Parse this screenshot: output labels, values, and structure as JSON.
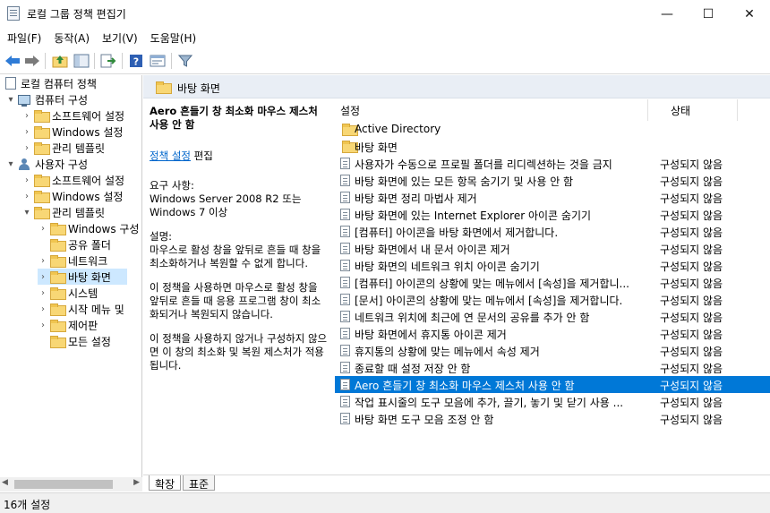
{
  "window": {
    "title": "로컬 그룹 정책 편집기",
    "minimize": "—",
    "maximize": "☐",
    "close": "✕"
  },
  "menu": [
    "파일(F)",
    "동작(A)",
    "보기(V)",
    "도움말(H)"
  ],
  "toolbar": {
    "icons": [
      "back-arrow-icon",
      "forward-arrow-icon",
      "up-folder-icon",
      "show-hide-tree-icon",
      "export-list-icon",
      "help-icon",
      "properties-icon",
      "filter-icon"
    ]
  },
  "tree": {
    "items": [
      {
        "label": "로컬 컴퓨터 정책"
      },
      {
        "label": "컴퓨터 구성"
      },
      {
        "label": "소프트웨어 설정"
      },
      {
        "label": "Windows 설정"
      },
      {
        "label": "관리 템플릿"
      },
      {
        "label": "사용자 구성"
      },
      {
        "label": "소프트웨어 설정"
      },
      {
        "label": "Windows 설정"
      },
      {
        "label": "관리 템플릿"
      },
      {
        "label": "Windows 구성"
      },
      {
        "label": "공유 폴더"
      },
      {
        "label": "네트워크"
      },
      {
        "label": "바탕 화면"
      },
      {
        "label": "시스템"
      },
      {
        "label": "시작 메뉴 및"
      },
      {
        "label": "제어판"
      },
      {
        "label": "모든 설정"
      }
    ]
  },
  "header": {
    "folder_title": "바탕 화면"
  },
  "description": {
    "title": "Aero 흔들기 창 최소화 마우스 제스처 사용 안 함",
    "edit_link": "정책 설정",
    "edit_suffix": " 편집",
    "requirements": "요구 사항:\nWindows Server 2008 R2 또는 Windows 7 이상",
    "description": "설명:\n마우스로 활성 창을 앞뒤로 흔들 때 창을 최소화하거나 복원할 수 없게 합니다.",
    "enabled_text": "이 정책을 사용하면 마우스로 활성 창을 앞뒤로 흔들 때 응용 프로그램 창이 최소화되거나 복원되지 않습니다.",
    "disabled_text": "이 정책을 사용하지 않거나 구성하지 않으면 이 창의 최소화 및 복원 제스처가 적용됩니다."
  },
  "columns": {
    "setting": "설정",
    "state": "상태"
  },
  "rows": [
    {
      "type": "folder",
      "name": "Active Directory",
      "state": ""
    },
    {
      "type": "folder",
      "name": "바탕 화면",
      "state": ""
    },
    {
      "type": "setting",
      "name": "사용자가 수동으로 프로필 폴더를 리디렉션하는 것을 금지",
      "state": "구성되지 않음"
    },
    {
      "type": "setting",
      "name": "바탕 화면에 있는 모든 항목 숨기기 및 사용 안 함",
      "state": "구성되지 않음"
    },
    {
      "type": "setting",
      "name": "바탕 화면 정리 마법사 제거",
      "state": "구성되지 않음"
    },
    {
      "type": "setting",
      "name": "바탕 화면에 있는 Internet Explorer 아이콘 숨기기",
      "state": "구성되지 않음"
    },
    {
      "type": "setting",
      "name": "[컴퓨터] 아이콘을 바탕 화면에서 제거합니다.",
      "state": "구성되지 않음"
    },
    {
      "type": "setting",
      "name": "바탕 화면에서 내 문서 아이콘 제거",
      "state": "구성되지 않음"
    },
    {
      "type": "setting",
      "name": "바탕 화면의 네트워크 위치 아이콘 숨기기",
      "state": "구성되지 않음"
    },
    {
      "type": "setting",
      "name": "[컴퓨터] 아이콘의 상황에 맞는 메뉴에서 [속성]을 제거합니...",
      "state": "구성되지 않음"
    },
    {
      "type": "setting",
      "name": "[문서] 아이콘의 상황에 맞는 메뉴에서 [속성]을 제거합니다.",
      "state": "구성되지 않음"
    },
    {
      "type": "setting",
      "name": "네트워크 위치에 최근에 연 문서의 공유를 추가 안 함",
      "state": "구성되지 않음"
    },
    {
      "type": "setting",
      "name": "바탕 화면에서 휴지통 아이콘 제거",
      "state": "구성되지 않음"
    },
    {
      "type": "setting",
      "name": "휴지통의 상황에 맞는 메뉴에서 속성 제거",
      "state": "구성되지 않음"
    },
    {
      "type": "setting",
      "name": "종료할 때 설정 저장 안 함",
      "state": "구성되지 않음"
    },
    {
      "type": "setting",
      "name": "Aero 흔들기 창 최소화 마우스 제스처 사용 안 함",
      "state": "구성되지 않음"
    },
    {
      "type": "setting",
      "name": "작업 표시줄의 도구 모음에 추가, 끌기, 놓기 및 닫기 사용 ...",
      "state": "구성되지 않음"
    },
    {
      "type": "setting",
      "name": "바탕 화면 도구 모음 조정 안 함",
      "state": "구성되지 않음"
    }
  ],
  "tabs": [
    "확장",
    "표준"
  ],
  "status": {
    "text": "16개 설정"
  },
  "colors": {
    "selection": "#0078d7",
    "header_band": "#e9eef5",
    "tree_selection": "#cde8ff"
  }
}
